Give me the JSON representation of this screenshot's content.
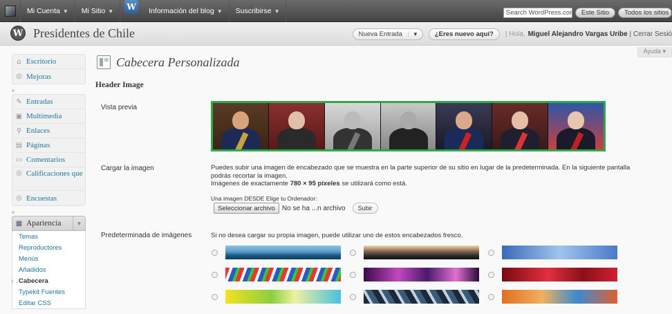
{
  "adminbar": {
    "mi_cuenta": "Mi Cuenta",
    "mi_sitio": "Mi Sitio",
    "blog_info": "Información del blog",
    "suscribirse": "Suscribirse",
    "search_placeholder": "Search WordPress.com",
    "este_sitio": "Este Sitio",
    "todos_sitios": "Todos los sitios d"
  },
  "header": {
    "site_title": "Presidentes de Chile",
    "new_entry": "Nueva Entrada",
    "whats_new": "¿Eres nuevo aquí?",
    "greeting_prefix": "| Hola,",
    "user_name": "Miguel Alejandro Vargas Uribe",
    "logout": "| Cerrar Sesió"
  },
  "help": {
    "label": "Ayuda ▾"
  },
  "sidebar": {
    "group1": [
      {
        "label": "Escritorio",
        "icon": "home-icon"
      },
      {
        "label": "Mejoras",
        "icon": "upgrade-icon"
      }
    ],
    "group2": [
      {
        "label": "Entradas",
        "icon": "pin-icon"
      },
      {
        "label": "Multimedia",
        "icon": "media-icon"
      },
      {
        "label": "Enlaces",
        "icon": "link-icon"
      },
      {
        "label": "Páginas",
        "icon": "page-icon"
      },
      {
        "label": "Comentarios",
        "icon": "comment-icon"
      },
      {
        "label": "Calificaciones que",
        "icon": "rating-icon"
      },
      {
        "label": "Encuestas",
        "icon": "poll-icon"
      }
    ],
    "appearance": {
      "label": "Apariencia",
      "items": [
        "Temas",
        "Reproductores",
        "Menús",
        "Añadidos",
        "Cabecera",
        "Typekit Fuentes",
        "Editar CSS"
      ],
      "current": "Cabecera"
    }
  },
  "main": {
    "page_title": "Cabecera Personalizada",
    "section_title": "Header Image",
    "preview_label": "Vista previa",
    "upload_label": "Cargar la imagen",
    "upload_desc_1": "Puedes subir una imagen de encabezado que se muestra en la parte superior de su sitio en lugar de la predeterminada. En la siguiente pantalla",
    "upload_desc_2": "podrás recortar la imagen.",
    "upload_desc_3a": "Imágenes de exactamente",
    "upload_desc_3b": "780 × 95 píxeles",
    "upload_desc_3c": "se utilizará como está.",
    "upload_sub": "Una imagen DESDE Elige tu Ordenador:",
    "file_button": "Seleccionar archivo",
    "file_none": "No se ha ...n archivo",
    "submit": "Subir",
    "defaults_label": "Predeterminada de imágenes",
    "defaults_desc": "Si no desea cargar su propia imagen, puede utilizar uno de estos encabezados fresco."
  },
  "colors": {
    "adminbar": "#464646",
    "link": "#21759b",
    "preview_border": "#2ea84a"
  }
}
